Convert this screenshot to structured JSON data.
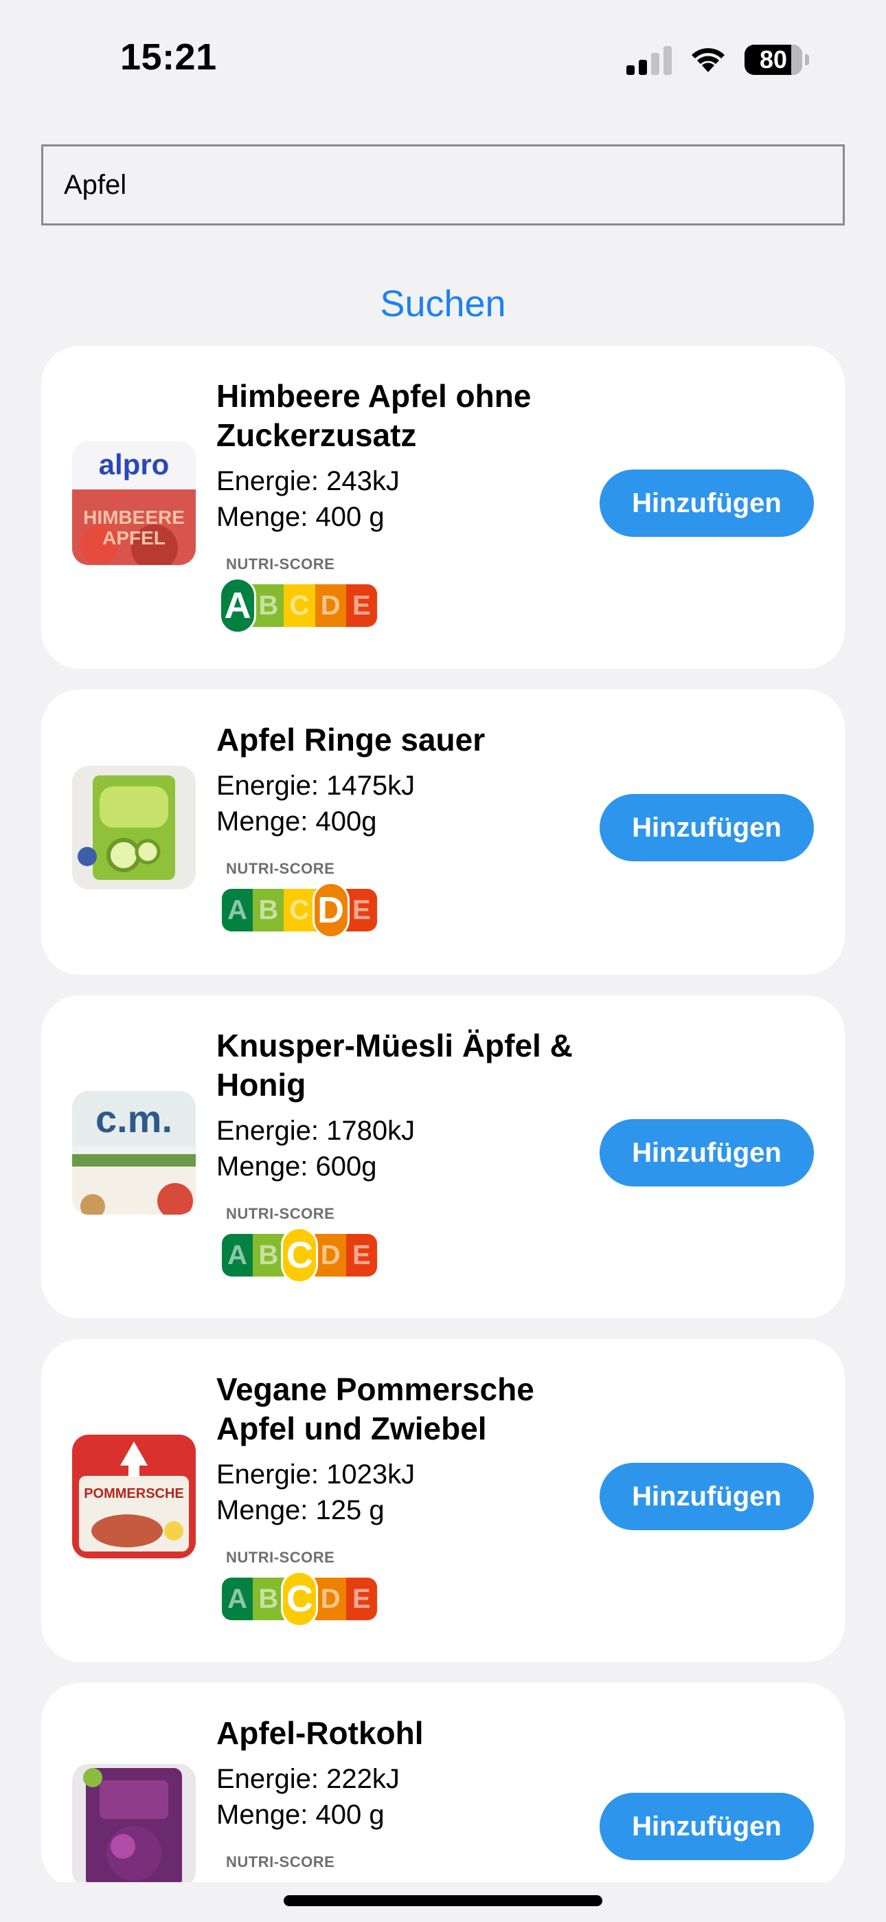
{
  "status_bar": {
    "time": "15:21",
    "battery": "80"
  },
  "search": {
    "value": "Apfel",
    "button_label": "Suchen"
  },
  "nutri_colors": [
    "#038141",
    "#85bb2f",
    "#fecb02",
    "#ee8100",
    "#e63e11"
  ],
  "nutri_label": "NUTRI-SCORE",
  "nutri_letters": [
    "A",
    "B",
    "C",
    "D",
    "E"
  ],
  "products": [
    {
      "name_line1": "Himbeere Apfel ohne",
      "name_line2": "Zuckerzusatz",
      "energy": "Energie: 243kJ",
      "amount": "Menge: 400 g",
      "nutriscore": "A",
      "image": "alpro-raspberry-apple-yogurt-image",
      "image_text": "alpro",
      "add_label": "Hinzufügen"
    },
    {
      "name_line1": "Apfel Ringe sauer",
      "name_line2": "",
      "energy": "Energie: 1475kJ",
      "amount": "Menge: 400g",
      "nutriscore": "D",
      "image": "sour-apple-rings-bag-image",
      "image_text": "",
      "add_label": "Hinzufügen"
    },
    {
      "name_line1": "Knusper-Müesli Äpfel &",
      "name_line2": "Honig",
      "energy": "Energie: 1780kJ",
      "amount": "Menge: 600g",
      "nutriscore": "C",
      "image": "cm-plus-muesli-box-image",
      "image_text": "c.m.",
      "add_label": "Hinzufügen"
    },
    {
      "name_line1": "Vegane Pommersche",
      "name_line2": "Apfel und Zwiebel",
      "energy": "Energie: 1023kJ",
      "amount": "Menge: 125 g",
      "nutriscore": "C",
      "image": "ruegenwalder-pommersche-spread-image",
      "image_text": "POMMERSCHE",
      "add_label": "Hinzufügen"
    },
    {
      "name_line1": "Apfel-Rotkohl",
      "name_line2": "",
      "energy": "Energie: 222kJ",
      "amount": "Menge: 400 g",
      "nutriscore": "",
      "image": "apple-red-cabbage-pouch-image",
      "image_text": "",
      "add_label": "Hinzufügen"
    }
  ]
}
